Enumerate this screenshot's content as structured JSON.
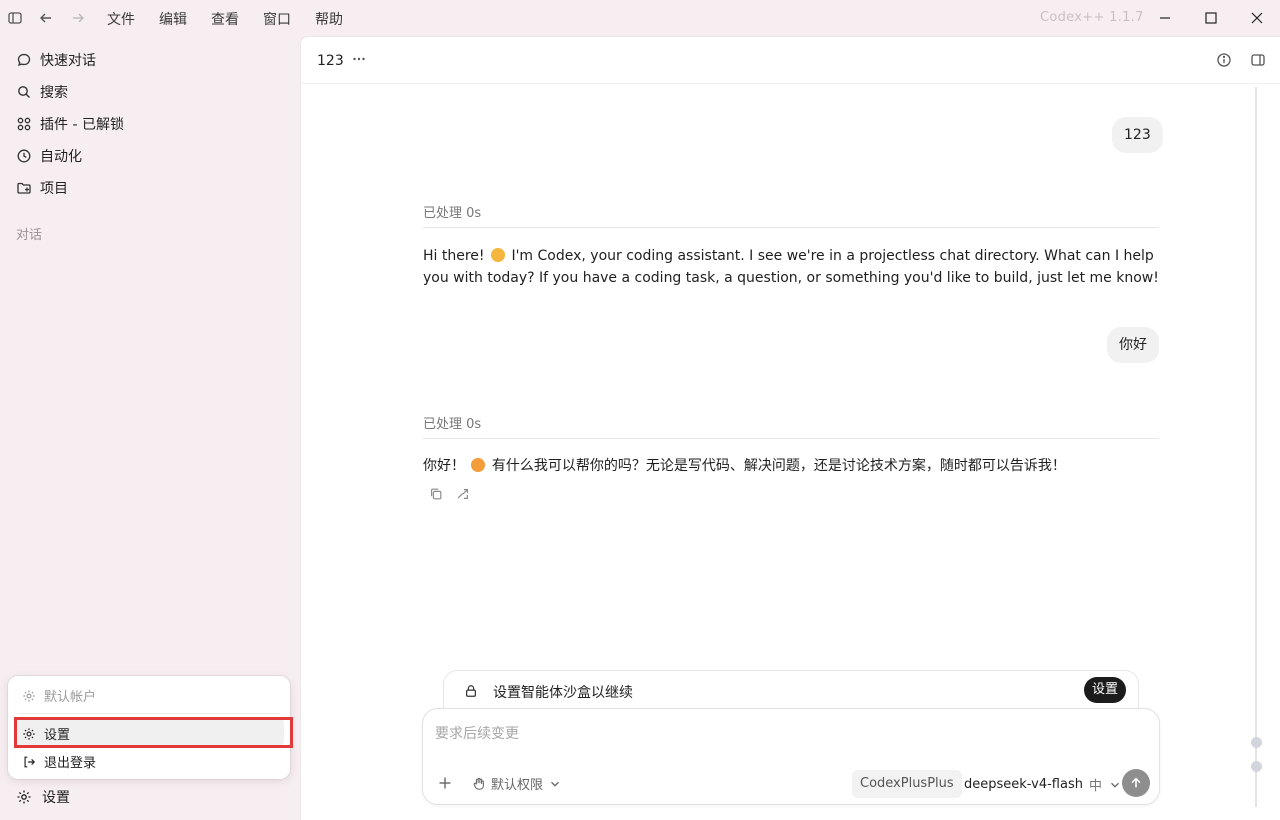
{
  "titlebar": {
    "menus": [
      "文件",
      "编辑",
      "查看",
      "窗口",
      "帮助"
    ],
    "app_version": "Codex++ 1.1.7"
  },
  "sidebar": {
    "items": [
      {
        "label": "快速对话",
        "icon": "chat-bubble-icon"
      },
      {
        "label": "搜索",
        "icon": "search-icon"
      },
      {
        "label": "插件 - 已解锁",
        "icon": "grid-icon"
      },
      {
        "label": "自动化",
        "icon": "clock-icon"
      },
      {
        "label": "项目",
        "icon": "folder-icon"
      }
    ],
    "section_label": "对话",
    "settings_label": "设置"
  },
  "account_menu": {
    "account_label": "默认帐户",
    "settings_label": "设置",
    "logout_label": "退出登录",
    "highlight_color": "#e23a3a"
  },
  "conversation": {
    "title": "123",
    "messages": [
      {
        "role": "user",
        "text": "123"
      },
      {
        "role": "assistant",
        "status": "已处理 0s",
        "text_before_emoji": "Hi there!",
        "emoji": "waving-hand",
        "text_after_emoji": "I'm Codex, your coding assistant. I see we're in a projectless chat directory. What can I help you with today? If you have a coding task, a question, or something you'd like to build, just let me know!"
      },
      {
        "role": "user",
        "text": "你好"
      },
      {
        "role": "assistant",
        "status": "已处理 0s",
        "text_before_emoji": "你好！",
        "emoji": "smiling-face",
        "text_after_emoji": "有什么我可以帮你的吗？无论是写代码、解决问题，还是讨论技术方案，随时都可以告诉我！"
      }
    ]
  },
  "sandbox_banner": {
    "text": "设置智能体沙盒以继续",
    "button_label": "设置"
  },
  "composer": {
    "placeholder": "要求后续变更",
    "permission_label": "默认权限",
    "provider_chip": "CodexPlusPlus",
    "model": "deepseek-v4-flash",
    "reasoning_level": "中"
  }
}
